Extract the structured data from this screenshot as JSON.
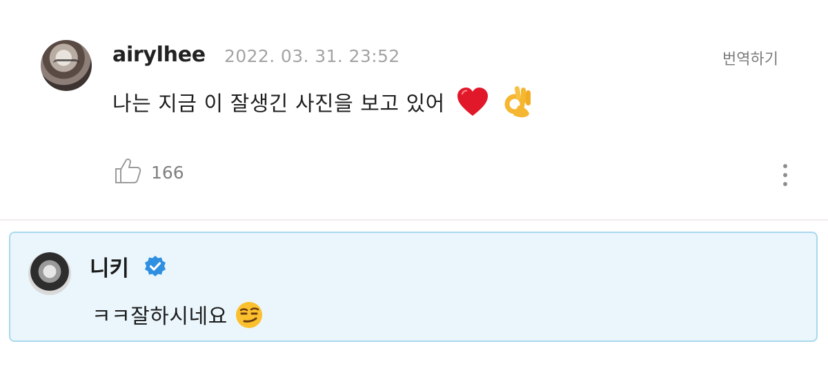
{
  "comment": {
    "username": "airylhee",
    "timestamp": "2022. 03. 31. 23:52",
    "translate_label": "번역하기",
    "text": "나는 지금 이 잘생긴 사진을 보고 있어",
    "emojis": [
      "heart-emoji",
      "ok-hand-emoji"
    ],
    "like_count": "166",
    "colors": {
      "username": "#222222",
      "timestamp": "#a3a3a3",
      "translate": "#7b7b7b"
    }
  },
  "reply": {
    "name": "니키",
    "verified": true,
    "text": "ㅋㅋ잘하시네요",
    "emoji": "smirk-emoji",
    "colors": {
      "background": "#eaf6fc",
      "border": "#a9d8ee",
      "verified_badge": "#2f8fe0"
    }
  }
}
